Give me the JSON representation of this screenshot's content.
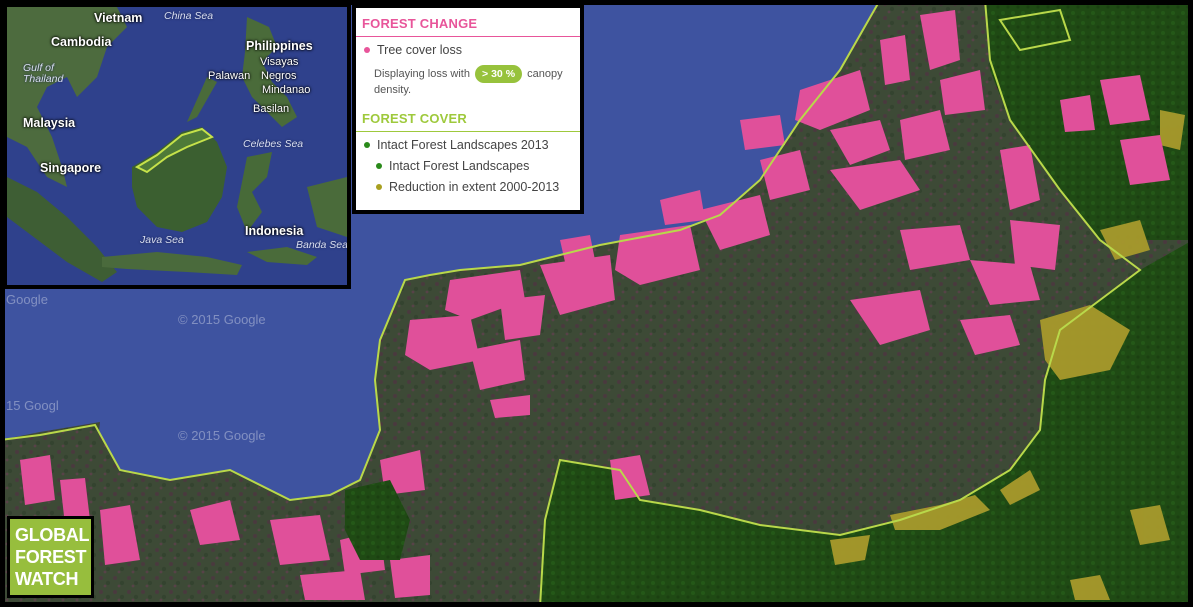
{
  "legend": {
    "forest_change_title": "FOREST CHANGE",
    "tree_cover_loss_label": "Tree cover loss",
    "loss_desc_prefix": "Displaying loss with",
    "threshold_value": "> 30 %",
    "loss_desc_suffix": "canopy density.",
    "forest_cover_title": "FOREST COVER",
    "ifl_2013_label": "Intact Forest Landscapes 2013",
    "ifl_label": "Intact Forest Landscapes",
    "reduction_label": "Reduction in extent 2000-2013",
    "colors": {
      "tree_cover_loss": "#e8559a",
      "forest_change_title": "#e8559a",
      "forest_cover_title": "#9ec93c",
      "ifl_2013": "#2a8a1a",
      "ifl": "#2a8a1a",
      "reduction": "#a8a020"
    }
  },
  "inset_map": {
    "labels": {
      "vietnam": "Vietnam",
      "china_sea": "China Sea",
      "cambodia": "Cambodia",
      "philippines": "Philippines",
      "gulf_of_thailand": "Gulf of Thailand",
      "visayas": "Visayas",
      "palawan": "Palawan",
      "negros": "Negros",
      "mindanao": "Mindanao",
      "basilan": "Basilan",
      "malaysia": "Malaysia",
      "celebes_sea": "Celebes Sea",
      "singapore": "Singapore",
      "indonesia": "Indonesia",
      "java_sea": "Java Sea",
      "banda_sea": "Banda Sea"
    }
  },
  "watermarks": {
    "w1": "© 2015 Google",
    "w2": "© 2015 Google",
    "w3": "15 Googl",
    "w4": "Google"
  },
  "logo": {
    "line1": "GLOBAL",
    "line2": "FOREST",
    "line3": "WATCH"
  }
}
